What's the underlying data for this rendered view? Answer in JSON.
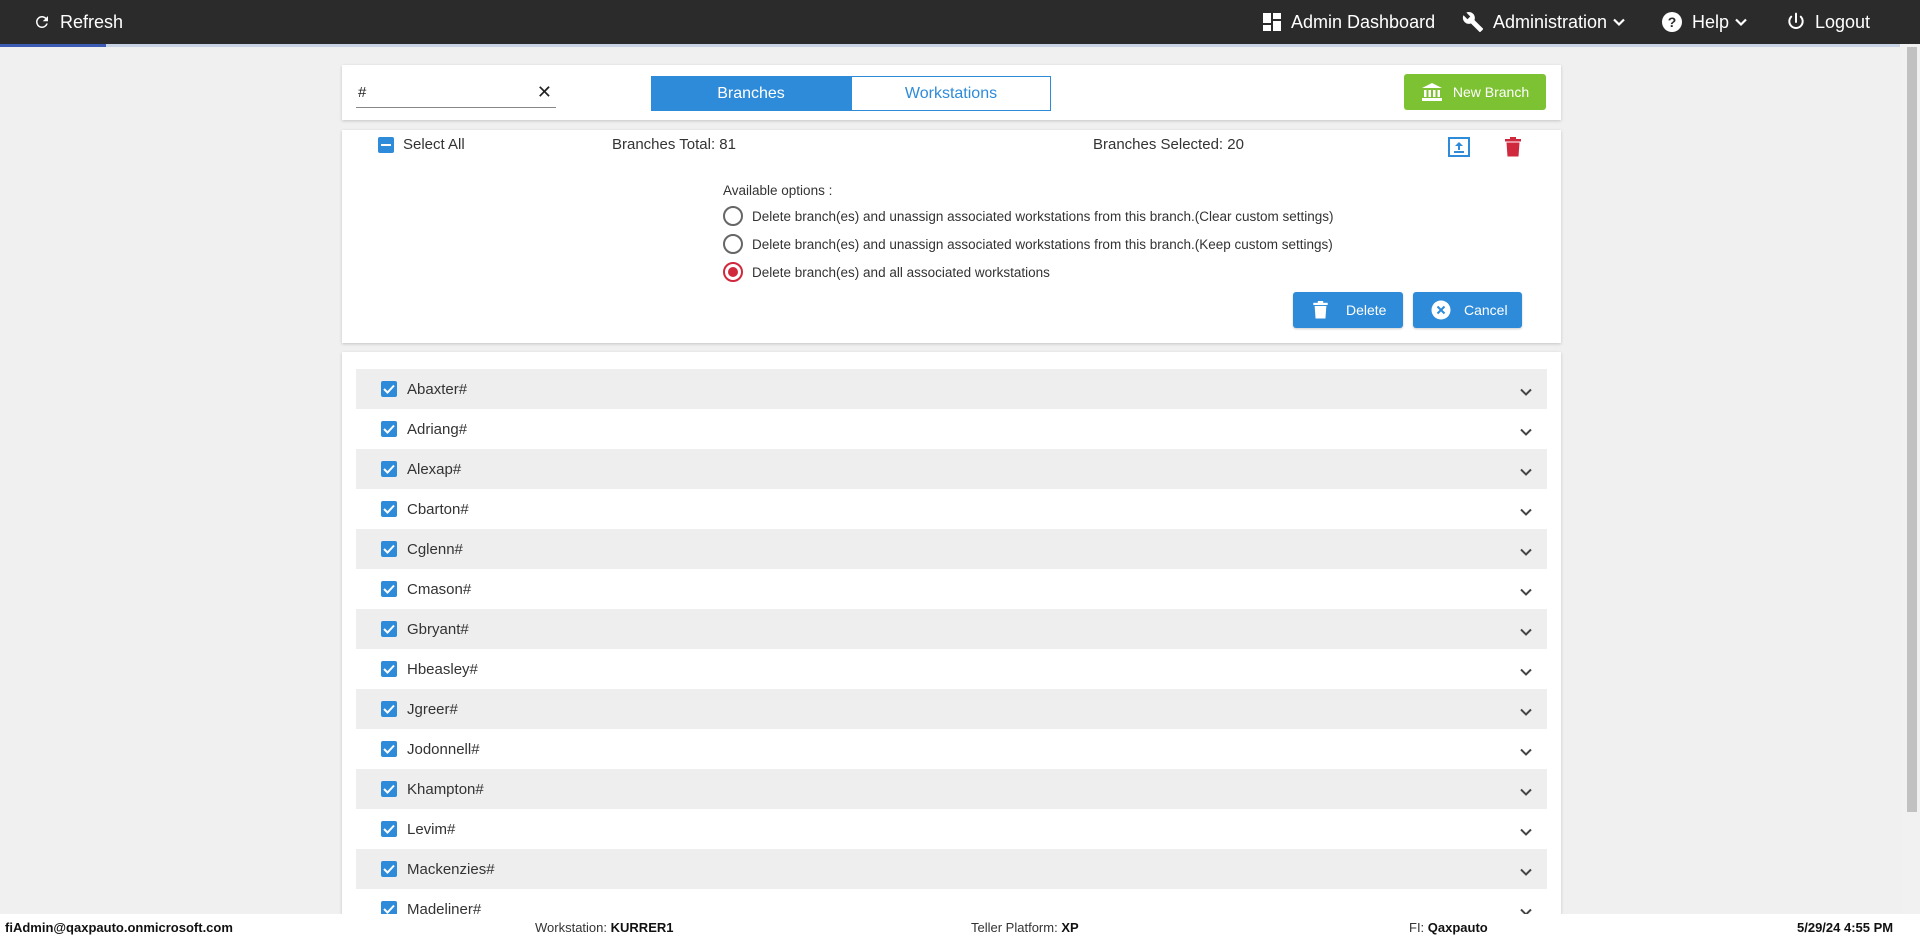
{
  "topbar": {
    "refresh_label": "Refresh",
    "admin_dashboard_label": "Admin Dashboard",
    "administration_label": "Administration",
    "help_label": "Help",
    "logout_label": "Logout",
    "progress_fraction": 0.056
  },
  "header": {
    "search_value": "#",
    "tabs": {
      "branches": "Branches",
      "workstations": "Workstations"
    },
    "active_tab": "branches",
    "new_branch_label": "New Branch"
  },
  "options": {
    "select_all_label": "Select All",
    "branches_total": "Branches Total: 81",
    "branches_selected": "Branches Selected: 20",
    "available_label": "Available options :",
    "choices": [
      "Delete branch(es) and unassign associated workstations from this branch.(Clear custom settings)",
      "Delete branch(es) and unassign associated workstations from this branch.(Keep custom settings)",
      "Delete branch(es) and all associated workstations"
    ],
    "selected_choice": 2,
    "delete_label": "Delete",
    "cancel_label": "Cancel"
  },
  "branches": [
    {
      "name": "Abaxter#",
      "checked": true
    },
    {
      "name": "Adriang#",
      "checked": true
    },
    {
      "name": "Alexap#",
      "checked": true
    },
    {
      "name": "Cbarton#",
      "checked": true
    },
    {
      "name": "Cglenn#",
      "checked": true
    },
    {
      "name": "Cmason#",
      "checked": true
    },
    {
      "name": "Gbryant#",
      "checked": true
    },
    {
      "name": "Hbeasley#",
      "checked": true
    },
    {
      "name": "Jgreer#",
      "checked": true
    },
    {
      "name": "Jodonnell#",
      "checked": true
    },
    {
      "name": "Khampton#",
      "checked": true
    },
    {
      "name": "Levim#",
      "checked": true
    },
    {
      "name": "Mackenzies#",
      "checked": true
    },
    {
      "name": "Madeliner#",
      "checked": true
    }
  ],
  "status": {
    "user": "fiAdmin@qaxpauto.onmicrosoft.com",
    "workstation_label": "Workstation:",
    "workstation_value": "KURRER1",
    "platform_label": "Teller Platform:",
    "platform_value": "XP",
    "fi_label": "FI:",
    "fi_value": "Qaxpauto",
    "datetime": "5/29/24 4:55 PM"
  },
  "colors": {
    "accent": "#2e8bd9",
    "new_branch": "#7cc232",
    "danger": "#d0283c",
    "topbar": "#2b2b2b"
  }
}
